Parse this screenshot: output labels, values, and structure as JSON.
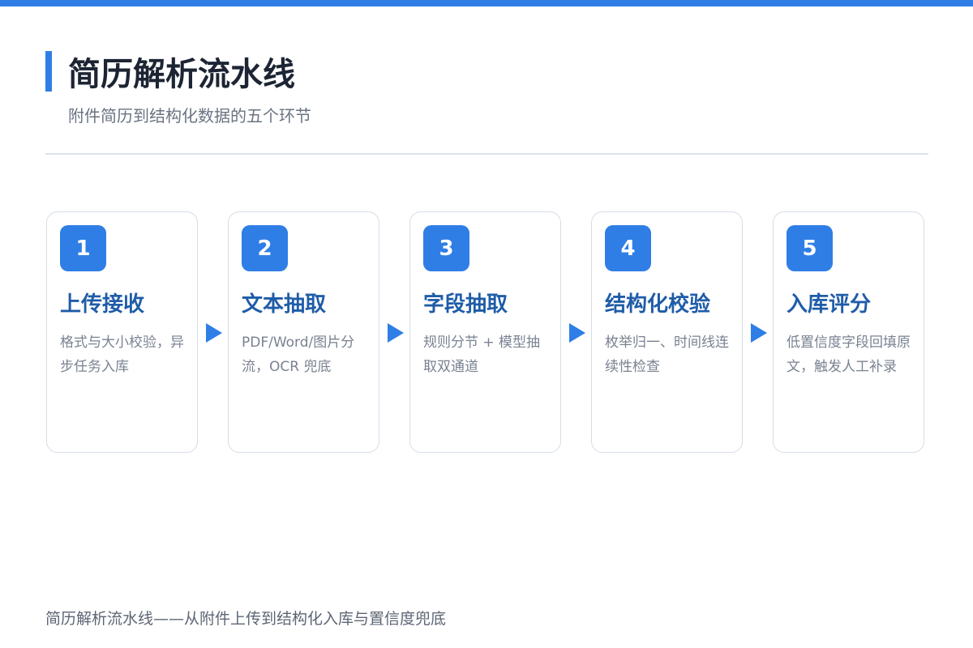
{
  "header": {
    "title": "简历解析流水线",
    "subtitle": "附件简历到结构化数据的五个环节"
  },
  "steps": [
    {
      "number": "1",
      "title": "上传接收",
      "desc": "格式与大小校验，异步任务入库"
    },
    {
      "number": "2",
      "title": "文本抽取",
      "desc": "PDF/Word/图片分流，OCR 兜底"
    },
    {
      "number": "3",
      "title": "字段抽取",
      "desc": "规则分节 + 模型抽取双通道"
    },
    {
      "number": "4",
      "title": "结构化校验",
      "desc": "枚举归一、时间线连续性检查"
    },
    {
      "number": "5",
      "title": "入库评分",
      "desc": "低置信度字段回填原文，触发人工补录"
    }
  ],
  "footer": {
    "caption": "简历解析流水线——从附件上传到结构化入库与置信度兜底"
  },
  "colors": {
    "accent": "#2f7ee6",
    "step_title": "#1f5ca8"
  }
}
